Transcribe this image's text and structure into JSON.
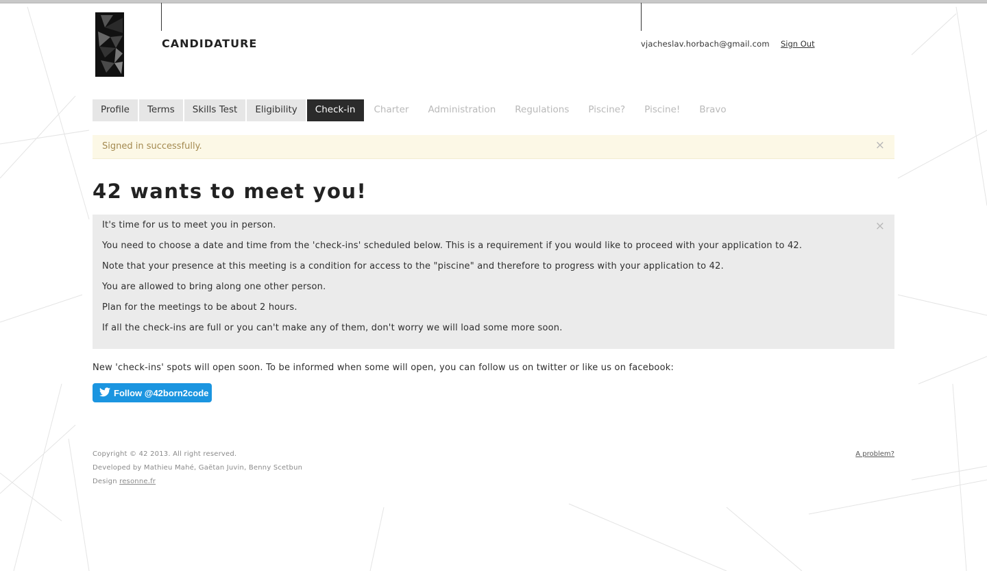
{
  "header": {
    "brand": "CANDIDATURE",
    "user_email": "vjacheslav.horbach@gmail.com",
    "sign_out": "Sign Out"
  },
  "tabs": [
    {
      "label": "Profile",
      "state": "done"
    },
    {
      "label": "Terms",
      "state": "done"
    },
    {
      "label": "Skills Test",
      "state": "done"
    },
    {
      "label": "Eligibility",
      "state": "done"
    },
    {
      "label": "Check-in",
      "state": "active"
    },
    {
      "label": "Charter",
      "state": "disabled"
    },
    {
      "label": "Administration",
      "state": "disabled"
    },
    {
      "label": "Regulations",
      "state": "disabled"
    },
    {
      "label": "Piscine?",
      "state": "disabled"
    },
    {
      "label": "Piscine!",
      "state": "disabled"
    },
    {
      "label": "Bravo",
      "state": "disabled"
    }
  ],
  "alert": {
    "text": "Signed in successfully.",
    "close": "×"
  },
  "main": {
    "title": "42 wants to meet you!",
    "info_close": "×",
    "info_lines": [
      "It's time for us to meet you in person.",
      "You need to choose a date and time from the 'check-ins' scheduled below. This is a requirement if you would like to proceed with your application to 42.",
      "Note that your presence at this meeting is a condition for access to the \"piscine\" and therefore to progress with your application to 42.",
      "You are allowed to bring along one other person.",
      "Plan for the meetings to be about 2 hours.",
      "If all the check-ins are full or you can't make any of them, don't worry we will load some more soon."
    ],
    "follow_text": "New 'check-ins' spots will open soon. To be informed when some will open, you can follow us on twitter or like us on facebook:",
    "twitter_button": "Follow @42born2code"
  },
  "footer": {
    "copyright": "Copyright © 42 2013. All right reserved.",
    "developed_by": "Developed by Mathieu Mahé, Gaëtan Juvin, Benny Scetbun",
    "design_prefix": "Design ",
    "design_link": "resonne.fr",
    "problem_link": "A problem?"
  },
  "colors": {
    "active_tab": "#2b2b2b",
    "tab_bg": "#e6e6e6",
    "alert_bg": "#fcf8e6",
    "alert_text": "#a48a50",
    "info_bg": "#ebebeb",
    "twitter_blue": "#1b95e0"
  },
  "icons": [
    "logo-42-icon",
    "close-icon",
    "twitter-bird-icon"
  ]
}
